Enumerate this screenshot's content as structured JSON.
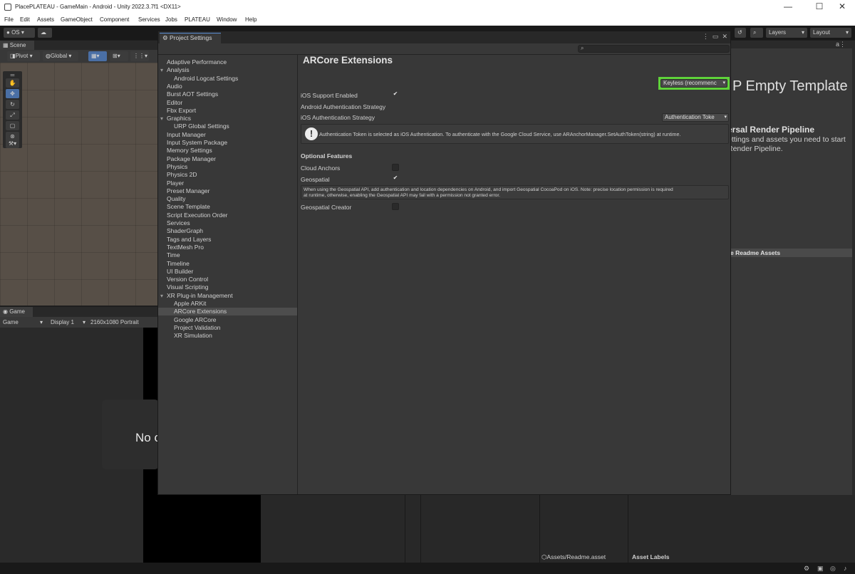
{
  "window": {
    "title": "PlacePLATEAU - GameMain - Android - Unity 2022.3.7f1 <DX11>",
    "minimize": "—",
    "maximize": "☐",
    "close": "✕"
  },
  "menu": [
    "File",
    "Edit",
    "Assets",
    "GameObject",
    "Component",
    "Services",
    "Jobs",
    "PLATEAU",
    "Window",
    "Help"
  ],
  "toolbar": {
    "account": "OS",
    "layers": "Layers",
    "layout": "Layout"
  },
  "scene": {
    "tab": "Scene",
    "pivot": "Pivot",
    "global": "Global"
  },
  "game": {
    "tab": "Game",
    "mode": "Game",
    "display": "Display 1",
    "resolution": "2160x1080 Portrait",
    "no_camera": "No c"
  },
  "project_settings": {
    "tab": "Project Settings",
    "search_placeholder": "",
    "nav": [
      {
        "label": "Adaptive Performance",
        "level": 0
      },
      {
        "label": "Analysis",
        "level": 0,
        "expanded": true
      },
      {
        "label": "Android Logcat Settings",
        "level": 1
      },
      {
        "label": "Audio",
        "level": 0
      },
      {
        "label": "Burst AOT Settings",
        "level": 0
      },
      {
        "label": "Editor",
        "level": 0
      },
      {
        "label": "Fbx Export",
        "level": 0
      },
      {
        "label": "Graphics",
        "level": 0,
        "expanded": true
      },
      {
        "label": "URP Global Settings",
        "level": 1
      },
      {
        "label": "Input Manager",
        "level": 0
      },
      {
        "label": "Input System Package",
        "level": 0
      },
      {
        "label": "Memory Settings",
        "level": 0
      },
      {
        "label": "Package Manager",
        "level": 0
      },
      {
        "label": "Physics",
        "level": 0
      },
      {
        "label": "Physics 2D",
        "level": 0
      },
      {
        "label": "Player",
        "level": 0
      },
      {
        "label": "Preset Manager",
        "level": 0
      },
      {
        "label": "Quality",
        "level": 0
      },
      {
        "label": "Scene Template",
        "level": 0
      },
      {
        "label": "Script Execution Order",
        "level": 0
      },
      {
        "label": "Services",
        "level": 0
      },
      {
        "label": "ShaderGraph",
        "level": 0
      },
      {
        "label": "Tags and Layers",
        "level": 0
      },
      {
        "label": "TextMesh Pro",
        "level": 0
      },
      {
        "label": "Time",
        "level": 0
      },
      {
        "label": "Timeline",
        "level": 0
      },
      {
        "label": "UI Builder",
        "level": 0
      },
      {
        "label": "Version Control",
        "level": 0
      },
      {
        "label": "Visual Scripting",
        "level": 0
      },
      {
        "label": "XR Plug-in Management",
        "level": 0,
        "expanded": true
      },
      {
        "label": "Apple ARKit",
        "level": 1
      },
      {
        "label": "ARCore Extensions",
        "level": 1,
        "selected": true
      },
      {
        "label": "Google ARCore",
        "level": 1
      },
      {
        "label": "Project Validation",
        "level": 1
      },
      {
        "label": "XR Simulation",
        "level": 1
      }
    ],
    "page": {
      "title": "ARCore Extensions",
      "ios_support_label": "iOS Support Enabled",
      "ios_support_checked": "✔",
      "android_auth_label": "Android Authentication Strategy",
      "android_auth_value": "Keyless (recommenc",
      "ios_auth_label": "iOS Authentication Strategy",
      "ios_auth_value": "Authentication Toke",
      "auth_help": "Authentication Token is selected as iOS Authentication. To authenticate with the Google Cloud Service, use ARAnchorManager.SetAuthToken(string) at runtime.",
      "optional_features": "Optional Features",
      "cloud_anchors_label": "Cloud Anchors",
      "geospatial_label": "Geospatial",
      "geospatial_checked": "✔",
      "geospatial_help_line1": "When using the Geospatial API, add authentication and location dependencies on Android, and import Geospatial CocoaPod on iOS. Note: precise location permission is required",
      "geospatial_help_line2": "at runtime, otherwise, enabling the Geospatial API may fail with a permission not granted error.",
      "geospatial_creator_label": "Geospatial Creator"
    }
  },
  "readme": {
    "title": "P Empty Template",
    "urp_heading": "ersal Render Pipeline",
    "urp_desc_line1": "ettings and assets you need to start",
    "urp_desc_line2": "Render Pipeline.",
    "assets_bar": "e Readme Assets"
  },
  "project_bottom": {
    "path": "Assets/Readme.asset",
    "labels": "Asset Labels"
  },
  "colors": {
    "highlight": "#5fd33a",
    "selection": "#4d4d4d"
  }
}
